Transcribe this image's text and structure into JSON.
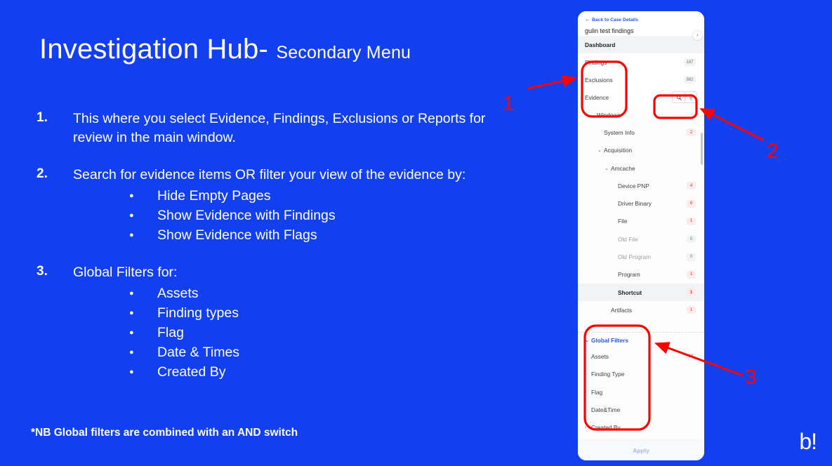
{
  "theme": {
    "background": "#1240F0",
    "text_on_background": "#FFFFFF",
    "annotation": "#FF0000",
    "accent_blue": "#2A56E8",
    "badge_hot_bg": "#FDECEC",
    "badge_hot_text": "#D93025"
  },
  "slide": {
    "title_main": "Investigation Hub",
    "title_dash": "-",
    "title_sub": "Secondary Menu",
    "footnote": "*NB Global filters are combined with an AND switch",
    "brand": "b!",
    "points": [
      {
        "number": "1.",
        "text": "This where you select Evidence, Findings, Exclusions or Reports for review in the main window.",
        "bullets": []
      },
      {
        "number": "2.",
        "text": "Search for evidence items OR filter your view of the evidence by:",
        "bullets": [
          "Hide Empty Pages",
          "Show Evidence with Findings",
          "Show Evidence with Flags"
        ]
      },
      {
        "number": "3.",
        "text": "Global Filters for:",
        "bullets": [
          "Assets",
          "Finding types",
          "Flag",
          "Date & Times",
          "Created By"
        ]
      }
    ]
  },
  "annotations": [
    {
      "label": "1",
      "points_to": "nav-group-findings-exclusions-evidence"
    },
    {
      "label": "2",
      "points_to": "search-and-filter-toolbar"
    },
    {
      "label": "3",
      "points_to": "global-filters-section"
    }
  ],
  "app": {
    "back_link": "Back to Case Details",
    "back_icon": "arrow-left-icon",
    "case_title": "gulin test findings",
    "collapse_icon": "chevron-left-icon",
    "nav": [
      {
        "label": "Dashboard",
        "badge": "",
        "active": true,
        "chevron": ""
      },
      {
        "label": "Findings",
        "badge": "187",
        "active": false,
        "chevron": ""
      },
      {
        "label": "Exclusions",
        "badge": "982",
        "active": false,
        "chevron": ""
      },
      {
        "label": "Evidence",
        "badge": "",
        "active": false,
        "chevron": "⌄"
      }
    ],
    "toolbar": {
      "search_icon": "search-icon",
      "filter_icon": "funnel-filter-icon"
    },
    "tree": [
      {
        "label": "Windows",
        "indent": 1,
        "chevron": "⌄",
        "badge": "",
        "state": "normal"
      },
      {
        "label": "System Info",
        "indent": 2,
        "chevron": "",
        "badge": "2",
        "state": "normal"
      },
      {
        "label": "Acquisition",
        "indent": 2,
        "chevron": "⌄",
        "badge": "",
        "state": "normal"
      },
      {
        "label": "Amcache",
        "indent": 3,
        "chevron": "⌄",
        "badge": "",
        "state": "normal"
      },
      {
        "label": "Device PNP",
        "indent": 4,
        "chevron": "",
        "badge": "4",
        "state": "normal"
      },
      {
        "label": "Driver Binary",
        "indent": 4,
        "chevron": "",
        "badge": "6",
        "state": "normal"
      },
      {
        "label": "File",
        "indent": 4,
        "chevron": "",
        "badge": "1",
        "state": "normal"
      },
      {
        "label": "Old File",
        "indent": 4,
        "chevron": "",
        "badge": "0",
        "state": "muted"
      },
      {
        "label": "Old Program",
        "indent": 4,
        "chevron": "",
        "badge": "0",
        "state": "muted"
      },
      {
        "label": "Program",
        "indent": 4,
        "chevron": "",
        "badge": "1",
        "state": "normal"
      },
      {
        "label": "Shortcut",
        "indent": 4,
        "chevron": "",
        "badge": "1",
        "state": "selected"
      },
      {
        "label": "Artifacts",
        "indent": 3,
        "chevron": "",
        "badge": "1",
        "state": "normal"
      }
    ],
    "global_filters": {
      "heading": "Global Filters",
      "heading_chevron": "⌄",
      "rows": [
        {
          "label": "Assets",
          "chevron": "",
          "badge": "12"
        },
        {
          "label": "Finding Type",
          "chevron": "›",
          "badge": ""
        },
        {
          "label": "Flag",
          "chevron": "›",
          "badge": ""
        },
        {
          "label": "Date&Time",
          "chevron": "›",
          "badge": ""
        },
        {
          "label": "Created By",
          "chevron": "›",
          "badge": ""
        }
      ]
    },
    "apply_label": "Apply"
  }
}
